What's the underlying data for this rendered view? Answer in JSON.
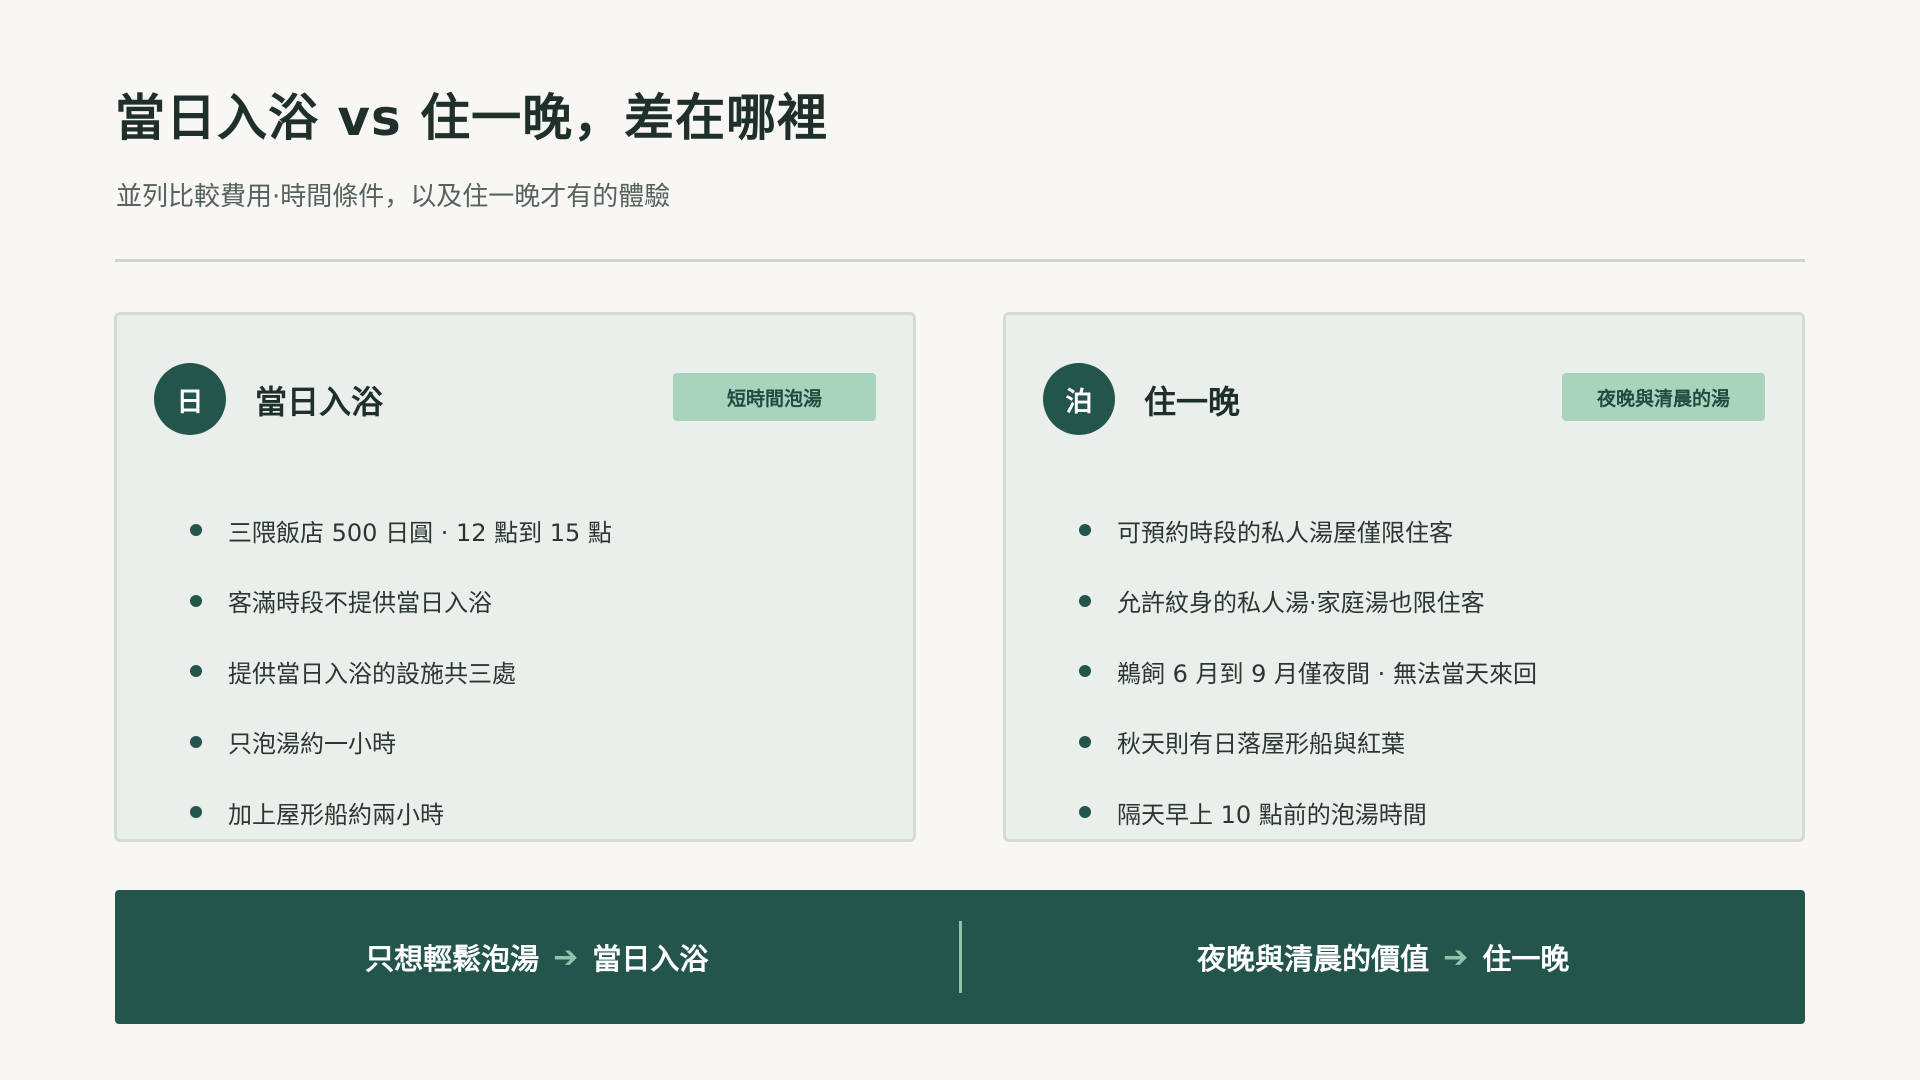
{
  "header": {
    "title": "當日入浴 vs 住一晚，差在哪裡",
    "subtitle": "並列比較費用·時間條件，以及住一晚才有的體驗"
  },
  "cards": [
    {
      "icon_char": "日",
      "title": "當日入浴",
      "tag": "短時間泡湯",
      "items": [
        "三隈飯店 500 日圓 · 12 點到 15 點",
        "客滿時段不提供當日入浴",
        "提供當日入浴的設施共三處",
        "只泡湯約一小時",
        "加上屋形船約兩小時"
      ]
    },
    {
      "icon_char": "泊",
      "title": "住一晚",
      "tag": "夜晚與清晨的湯",
      "items": [
        "可預約時段的私人湯屋僅限住客",
        "允許紋身的私人湯·家庭湯也限住客",
        "鵜飼 6 月到 9 月僅夜間 · 無法當天來回",
        "秋天則有日落屋形船與紅葉",
        "隔天早上 10 點前的泡湯時間"
      ]
    }
  ],
  "banner": {
    "left_text": "只想輕鬆泡湯",
    "left_target": "當日入浴",
    "right_text": "夜晚與清晨的價值",
    "right_target": "住一晚",
    "arrow": "➔"
  },
  "colors": {
    "background": "#f8f7f3",
    "accent": "#23554c",
    "tag": "#a8d4bd",
    "card": "#eaefeb"
  }
}
